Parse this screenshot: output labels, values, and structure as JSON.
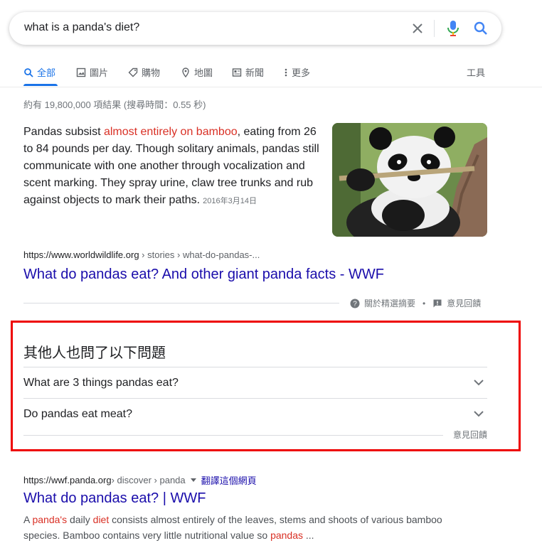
{
  "search": {
    "query": "what is a panda's diet?"
  },
  "tabs": [
    {
      "label": "全部",
      "icon": "search-icon",
      "active": true
    },
    {
      "label": "圖片",
      "icon": "image-icon"
    },
    {
      "label": "購物",
      "icon": "tag-icon"
    },
    {
      "label": "地圖",
      "icon": "map-pin-icon"
    },
    {
      "label": "新聞",
      "icon": "newspaper-icon"
    },
    {
      "label": "更多",
      "icon": "more-vert-icon"
    }
  ],
  "tools_label": "工具",
  "result_stats": "約有 19,800,000 項結果 (搜尋時間：0.55 秒)",
  "featured_snippet": {
    "text_before": "Pandas subsist ",
    "highlight": "almost entirely on bamboo",
    "text_after": ", eating from 26 to 84 pounds per day. Though solitary animals, pandas still communicate with one another through vocalization and scent marking. They spray urine, claw tree trunks and rub against objects to mark their paths.",
    "date": "2016年3月14日",
    "url_domain": "https://www.worldwildlife.org",
    "url_path": " › stories › what-do-pandas-...",
    "title": "What do pandas eat? And other giant panda facts - WWF",
    "about_label": "關於精選摘要",
    "separator": "•",
    "feedback_label": "意見回饋"
  },
  "people_also_ask": {
    "title": "其他人也問了以下問題",
    "questions": [
      "What are 3 things pandas eat?",
      "Do pandas eat meat?"
    ],
    "feedback_label": "意見回饋"
  },
  "result2": {
    "url_domain": "https://wwf.panda.org",
    "url_path": " › discover › panda",
    "translate_label": "翻譯這個網頁",
    "title": "What do pandas eat? | WWF",
    "desc": [
      {
        "t": "A ",
        "h": false
      },
      {
        "t": "panda's",
        "h": true
      },
      {
        "t": " daily ",
        "h": false
      },
      {
        "t": "diet",
        "h": true
      },
      {
        "t": " consists almost entirely of the leaves, stems and shoots of various bamboo species. Bamboo contains very little nutritional value so ",
        "h": false
      },
      {
        "t": "pandas",
        "h": true
      },
      {
        "t": " ...",
        "h": false
      }
    ]
  },
  "colors": {
    "link": "#1a0dab",
    "accent": "#1a73e8",
    "highlight": "#d93025",
    "annotation_box": "#ee0000"
  }
}
